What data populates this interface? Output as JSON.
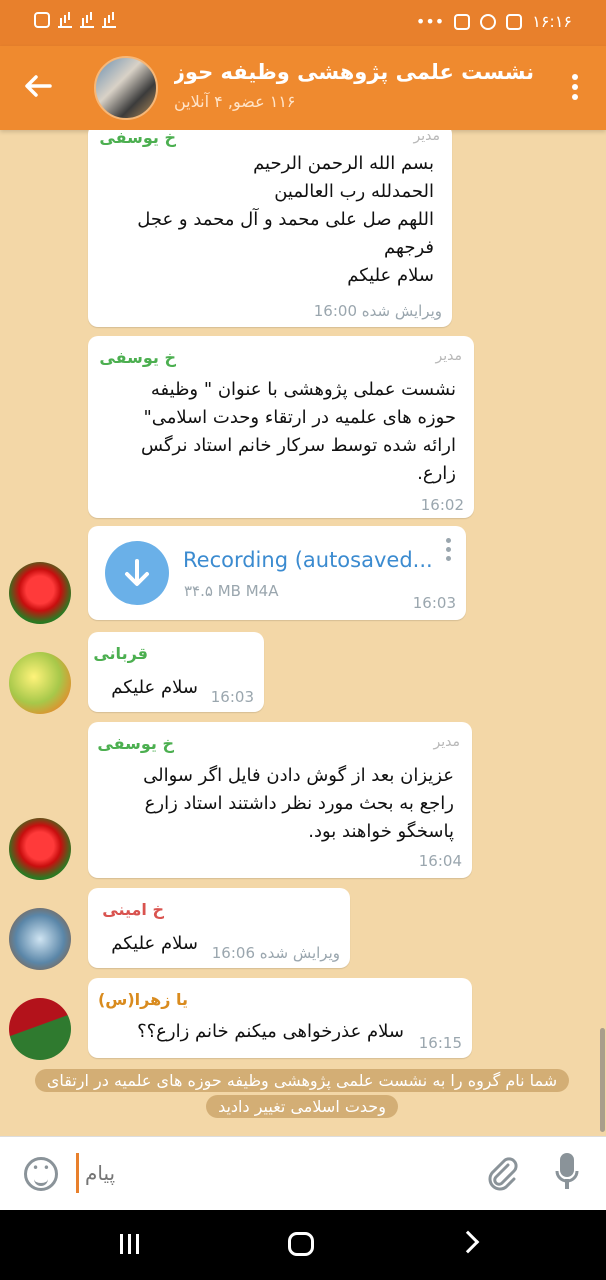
{
  "status_bar": {
    "time": "۱۶:۱۶",
    "dots": "•••"
  },
  "header": {
    "back_icon": "arrow-left-icon",
    "title": "نشست علمی پژوهشی وظیفه حوز...",
    "subtitle": "۱۱۶ عضو, ۴ آنلاین",
    "menu_icon": "vertical-dots-icon"
  },
  "messages": [
    {
      "sender": "خ یوسفی",
      "role": "مدیر",
      "text": "بسم الله الرحمن الرحیم\nالحمدلله رب العالمین\nاللهم صل علی محمد و آل محمد و عجل\nفرجهم\nسلام علیکم",
      "time": "ویرایش شده 16:00"
    },
    {
      "sender": "خ یوسفی",
      "role": "مدیر",
      "text": "نشست عملی پژوهشی با عنوان \" وظیفه\nحوزه های علمیه در ارتقاء  وحدت اسلامی\"\nارائه  شده توسط سرکار خانم استاد نرگس\nزارع.",
      "time": "16:02"
    },
    {
      "file_name": "Recording (autosaved...",
      "file_meta": "۳۴.۵ MB M4A",
      "time": "16:03"
    },
    {
      "sender": "قربانی",
      "text": "سلام علیکم",
      "time": "16:03"
    },
    {
      "sender": "خ یوسفی",
      "role": "مدیر",
      "text": "عزیزان بعد از گوش دادن فایل اگر سوالی\nراجع به بحث مورد نظر داشتند استاد زارع\nپاسخگو خواهند بود.",
      "time": "16:04"
    },
    {
      "sender": "خ امینی",
      "text": "سلام علیکم",
      "time": "ویرایش شده 16:06"
    },
    {
      "sender": "یا زهرا(س)",
      "text": "سلام عذرخواهی میکنم خانم زارع؟؟",
      "time": "16:15"
    }
  ],
  "service_message": "شما نام گروه را به نشست علمی پژوهشی وظیفه حوزه های علمیه در ارتقای وحدت اسلامی تغییر دادید",
  "input": {
    "placeholder": "پیام"
  },
  "colors": {
    "header": "#ef8a2f",
    "sender_green": "#4caf50",
    "sender_red": "#d9534f",
    "sender_orange": "#d98b1e",
    "link_blue": "#3b8bd0"
  }
}
